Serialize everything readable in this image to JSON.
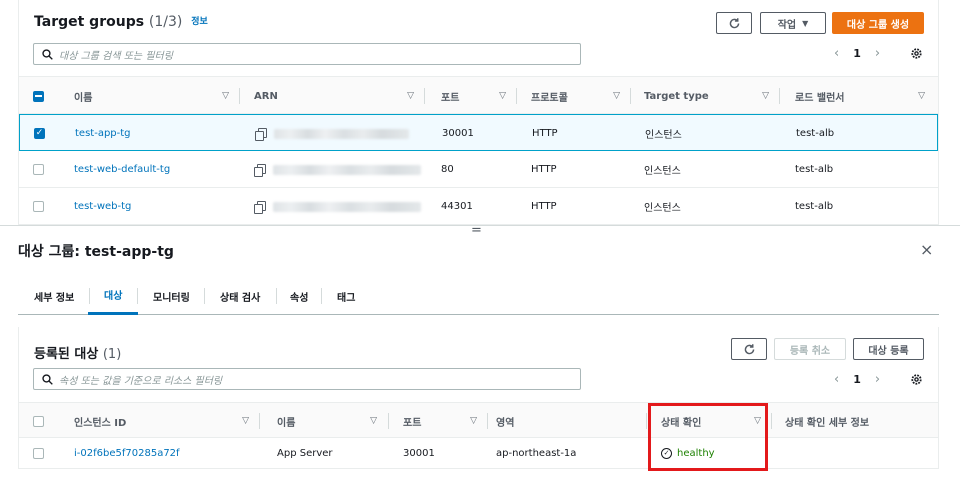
{
  "top": {
    "title": "Target groups",
    "count": "(1/3)",
    "info_link": "정보",
    "refresh_icon": "refresh-icon",
    "actions_label": "작업",
    "create_label": "대상 그룹 생성",
    "search_placeholder": "대상 그룹 검색 또는 필터링",
    "page": "1",
    "columns": [
      "이름",
      "ARN",
      "포트",
      "프로토콜",
      "Target type",
      "로드 밸런서"
    ],
    "rows": [
      {
        "name": "test-app-tg",
        "port": "30001",
        "protocol": "HTTP",
        "type": "인스턴스",
        "lb": "test-alb",
        "checked": true
      },
      {
        "name": "test-web-default-tg",
        "port": "80",
        "protocol": "HTTP",
        "type": "인스턴스",
        "lb": "test-alb",
        "checked": false
      },
      {
        "name": "test-web-tg",
        "port": "44301",
        "protocol": "HTTP",
        "type": "인스턴스",
        "lb": "test-alb",
        "checked": false
      }
    ]
  },
  "resize_handle": "=",
  "detail": {
    "title": "대상 그룹: test-app-tg",
    "close": "×",
    "tabs": [
      "세부 정보",
      "대상",
      "모니터링",
      "상태 검사",
      "속성",
      "태그"
    ],
    "active_tab": "대상",
    "section_title": "등록된 대상",
    "section_count": "(1)",
    "deregister_label": "등록 취소",
    "register_label": "대상 등록",
    "search_placeholder": "속성 또는 값을 기준으로 리소스 필터링",
    "page": "1",
    "columns": [
      "인스턴스 ID",
      "이름",
      "포트",
      "영역",
      "상태 확인",
      "상태 확인 세부 정보"
    ],
    "rows": [
      {
        "instance_id": "i-02f6be5f70285a72f",
        "name": "App Server",
        "port": "30001",
        "zone": "ap-northeast-1a",
        "health": "healthy",
        "details": ""
      }
    ]
  },
  "colors": {
    "accent": "#0073bb",
    "primary": "#ec7211",
    "healthy": "#1d8102",
    "highlight": "#e3191b"
  }
}
